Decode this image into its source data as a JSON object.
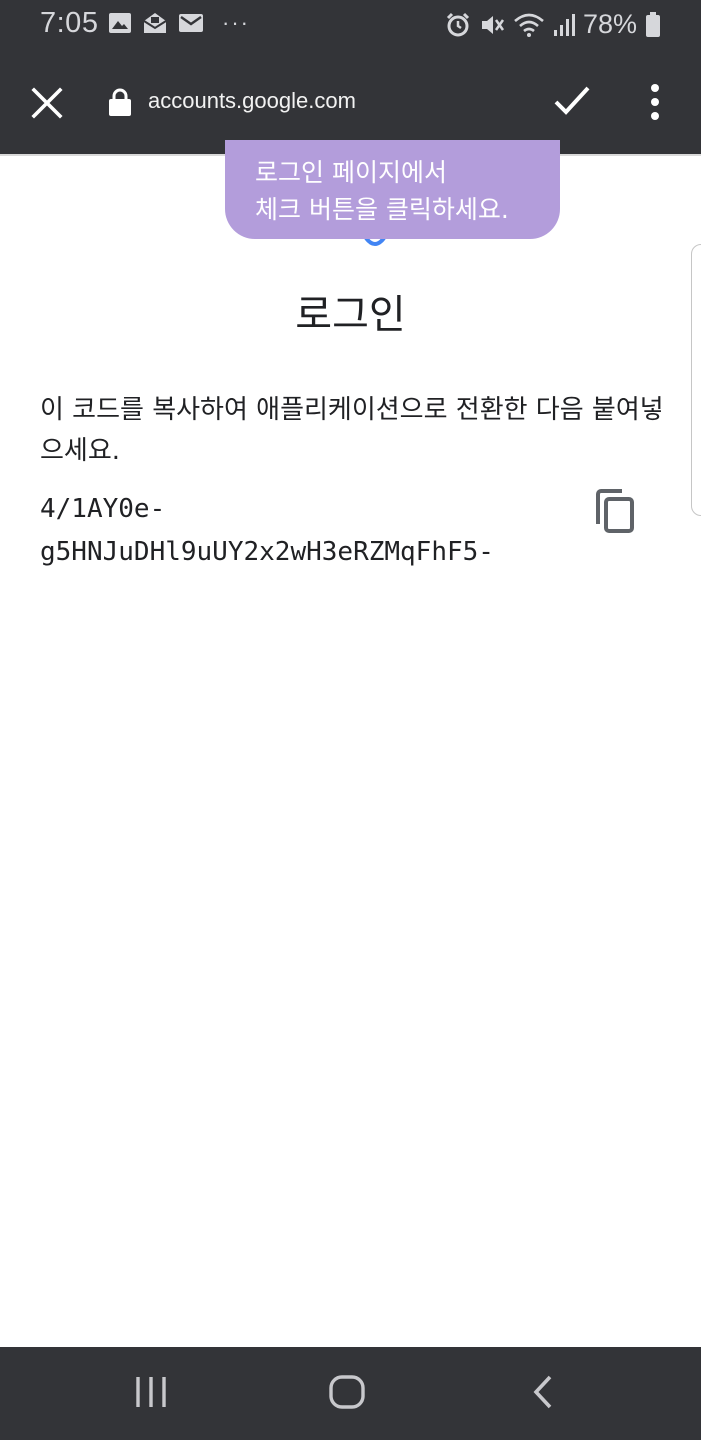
{
  "status_bar": {
    "time": "7:05",
    "battery_percent": "78%",
    "overflow_indicator": "···",
    "notification_icons": [
      "image-icon",
      "mail-open-icon",
      "mail-icon"
    ],
    "system_icons": [
      "alarm-icon",
      "mute-icon",
      "wifi-icon",
      "signal-icon",
      "battery-icon"
    ]
  },
  "toolbar": {
    "url": "accounts.google.com"
  },
  "tooltip": {
    "line1": "로그인 페이지에서",
    "line2": "체크 버튼을 클릭하세요."
  },
  "main": {
    "title": "로그인",
    "instruction": "이 코드를 복사하여 애플리케이션으로 전환한 다음 붙여넣으세요.",
    "code_line1": "4/1AY0e-",
    "code_line2": "g5HNJuDHl9uUY2x2wH3eRZMqFhF5-"
  },
  "colors": {
    "bar_background": "#333438",
    "tooltip_background": "#b39ddb",
    "google_blue": "#4285f4",
    "text": "#202124"
  }
}
